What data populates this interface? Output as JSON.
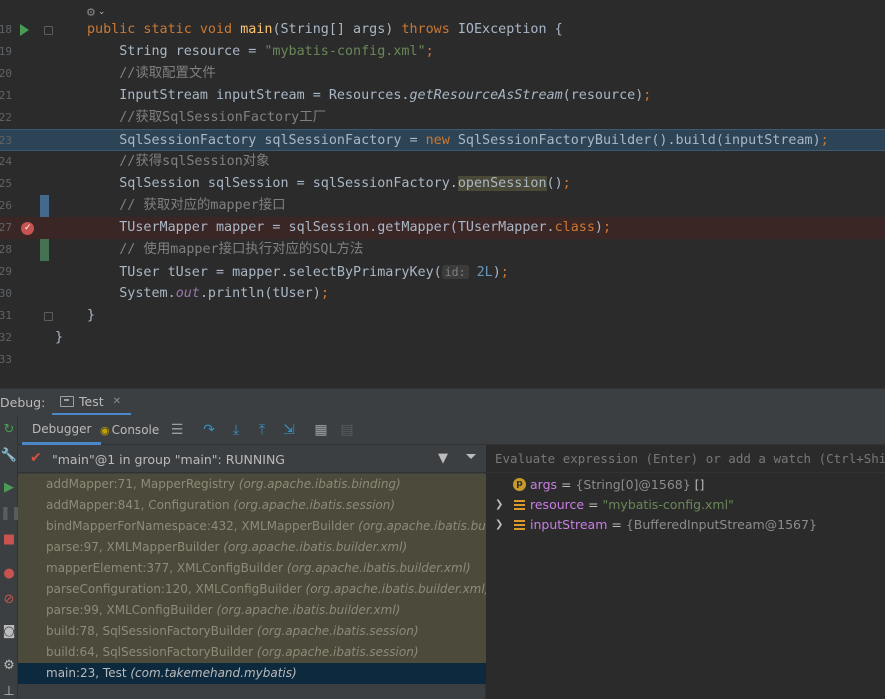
{
  "editor": {
    "hint": "⚙",
    "lines": [
      {
        "num": "18",
        "kind": "sig"
      },
      {
        "num": "19",
        "parts": [
          {
            "t": "    String resource = "
          },
          {
            "t": "\"mybatis-config.xml\"",
            "c": "str"
          },
          {
            "t": ";",
            "c": "kw"
          }
        ]
      },
      {
        "num": "20",
        "parts": [
          {
            "t": "    //读取配置文件",
            "c": "cm"
          }
        ]
      },
      {
        "num": "21",
        "parts": [
          {
            "t": "    InputStream inputStream = Resources."
          },
          {
            "t": "getResourceAsStream",
            "c": "it"
          },
          {
            "t": "(resource)"
          },
          {
            "t": ";",
            "c": "kw"
          }
        ]
      },
      {
        "num": "22",
        "parts": [
          {
            "t": "    //获取SqlSessionFactory工厂",
            "c": "cm"
          }
        ]
      },
      {
        "num": "23",
        "parts": [
          {
            "t": "    SqlSessionFactory sqlSessionFactory = "
          },
          {
            "t": "new",
            "c": "kw"
          },
          {
            "t": " SqlSessionFactoryBuilder().build(inputStream)"
          },
          {
            "t": ";",
            "c": "kw"
          }
        ]
      },
      {
        "num": "24",
        "parts": [
          {
            "t": "    //获得sqlSession对象",
            "c": "cm"
          }
        ]
      },
      {
        "num": "25",
        "parts": [
          {
            "t": "    SqlSession sqlSession = sqlSessionFactory."
          },
          {
            "t": "openSession",
            "c": "hl-call"
          },
          {
            "t": "()"
          },
          {
            "t": ";",
            "c": "kw"
          }
        ]
      },
      {
        "num": "26",
        "parts": [
          {
            "t": "    // 获取对应的mapper接口",
            "c": "cm"
          }
        ]
      },
      {
        "num": "27",
        "parts": [
          {
            "t": "    TUserMapper mapper = sqlSession.getMapper(TUserMapper."
          },
          {
            "t": "class",
            "c": "kw"
          },
          {
            "t": ")"
          },
          {
            "t": ";",
            "c": "kw"
          }
        ]
      },
      {
        "num": "28",
        "parts": [
          {
            "t": "    // 使用mapper接口执行对应的SQL方法",
            "c": "cm"
          }
        ]
      },
      {
        "num": "29",
        "kind": "hint"
      },
      {
        "num": "30",
        "parts": [
          {
            "t": "    System."
          },
          {
            "t": "out",
            "c": "sf"
          },
          {
            "t": ".println(tUser)"
          },
          {
            "t": ";",
            "c": "kw"
          }
        ]
      },
      {
        "num": "31",
        "parts": [
          {
            "t": "}"
          }
        ]
      },
      {
        "num": "32",
        "parts": [
          {
            "t": "}"
          }
        ],
        "outdent": true
      },
      {
        "num": "33",
        "parts": []
      }
    ],
    "signature": {
      "kw1": "public static void ",
      "fn": "main",
      "mid": "(String[] args) ",
      "kw2": "throws",
      "tail": " IOException {"
    },
    "hint_line": {
      "pre": "    TUser tUser = mapper.selectByPrimaryKey(",
      "param": "id:",
      "num": " 2L",
      "post": ")",
      "semi": ";"
    }
  },
  "debug": {
    "label": "Debug:",
    "run_tab": "Test",
    "tabs": {
      "debugger": "Debugger",
      "console": "Console"
    },
    "thread": "\"main\"@1 in group \"main\": RUNNING",
    "frames": [
      {
        "method": "addMapper:71, MapperRegistry ",
        "pkg": "(org.apache.ibatis.binding)"
      },
      {
        "method": "addMapper:841, Configuration ",
        "pkg": "(org.apache.ibatis.session)"
      },
      {
        "method": "bindMapperForNamespace:432, XMLMapperBuilder ",
        "pkg": "(org.apache.ibatis.builder.xml)"
      },
      {
        "method": "parse:97, XMLMapperBuilder ",
        "pkg": "(org.apache.ibatis.builder.xml)"
      },
      {
        "method": "mapperElement:377, XMLConfigBuilder ",
        "pkg": "(org.apache.ibatis.builder.xml)"
      },
      {
        "method": "parseConfiguration:120, XMLConfigBuilder ",
        "pkg": "(org.apache.ibatis.builder.xml)"
      },
      {
        "method": "parse:99, XMLConfigBuilder ",
        "pkg": "(org.apache.ibatis.builder.xml)"
      },
      {
        "method": "build:78, SqlSessionFactoryBuilder ",
        "pkg": "(org.apache.ibatis.session)"
      },
      {
        "method": "build:64, SqlSessionFactoryBuilder ",
        "pkg": "(org.apache.ibatis.session)"
      },
      {
        "method": "main:23, Test ",
        "pkg": "(com.takemehand.mybatis)",
        "selected": true
      }
    ],
    "evaluate_placeholder": "Evaluate expression (Enter) or add a watch (Ctrl+Shift+Enter)",
    "variables": [
      {
        "icon": "p",
        "name": "args",
        "value": "{String[0]@1568}",
        "tail": " []",
        "expandable": false
      },
      {
        "icon": "f",
        "name": "resource",
        "value": "\"mybatis-config.xml\"",
        "string": true,
        "expandable": true
      },
      {
        "icon": "f",
        "name": "inputStream",
        "value": "{BufferedInputStream@1567}",
        "expandable": true
      }
    ]
  },
  "colors": {
    "accent": "#4a88c7",
    "breakpoint": "#c75450",
    "run": "#499c54"
  }
}
